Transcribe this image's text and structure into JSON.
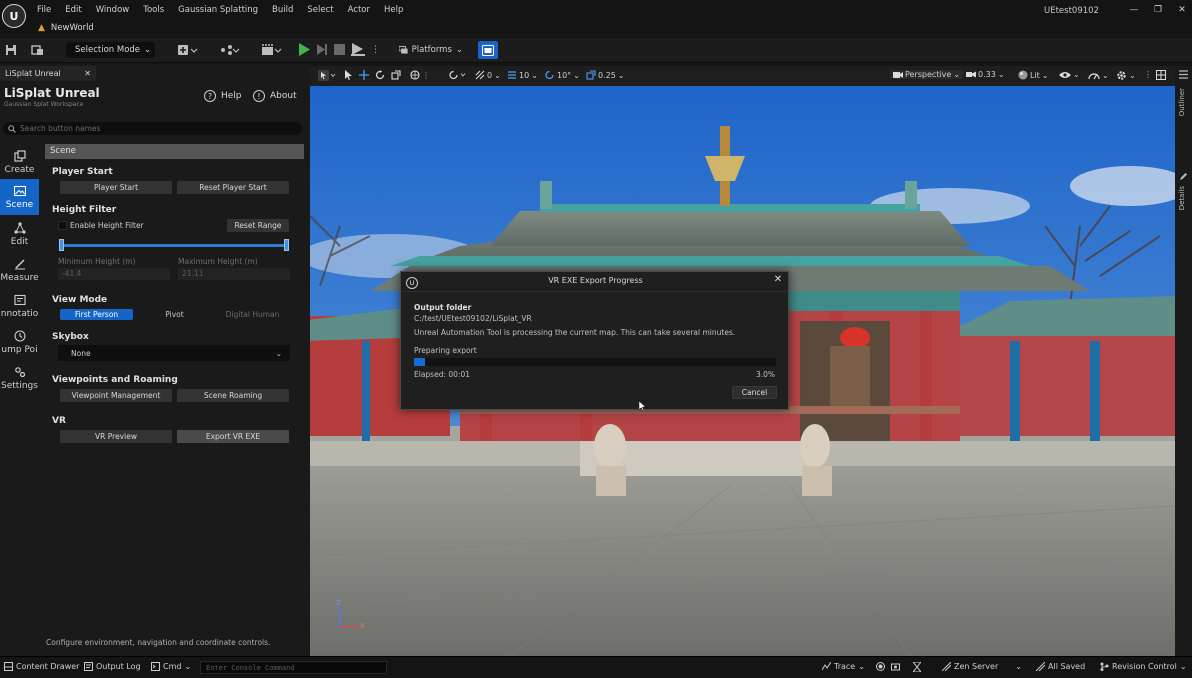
{
  "app": {
    "menu": [
      "File",
      "Edit",
      "Window",
      "Tools",
      "Gaussian Splatting",
      "Build",
      "Select",
      "Actor",
      "Help"
    ],
    "project_tab": "NewWorld",
    "window_title": "UEtest09102"
  },
  "toolbar": {
    "selection_mode": "Selection Mode",
    "platforms": "Platforms"
  },
  "panel": {
    "tab_label": "LiSplat Unreal",
    "title": "LiSplat Unreal",
    "subtitle": "Gaussian Splat Workspace",
    "help": "Help",
    "about": "About",
    "search_placeholder": "Search button names",
    "sidebar": [
      {
        "label": "Create",
        "icon": "create-icon"
      },
      {
        "label": "Scene",
        "icon": "image-icon",
        "active": true
      },
      {
        "label": "Edit",
        "icon": "edit-nodes-icon"
      },
      {
        "label": "Measure",
        "icon": "measure-icon"
      },
      {
        "label": "nnotatio",
        "icon": "annotation-icon"
      },
      {
        "label": "ump Poi",
        "icon": "jump-point-icon"
      },
      {
        "label": "Settings",
        "icon": "settings-icon"
      }
    ],
    "section_header": "Scene",
    "player_start": {
      "title": "Player Start",
      "btn_player_start": "Player Start",
      "btn_reset": "Reset Player Start"
    },
    "height_filter": {
      "title": "Height Filter",
      "enable_label": "Enable Height Filter",
      "enabled": false,
      "reset_range": "Reset Range",
      "min_label": "Minimum Height (m)",
      "min_value": "-41.4",
      "max_label": "Maximum Height (m)",
      "max_value": "21.11"
    },
    "view_mode": {
      "title": "View Mode",
      "options": [
        "First Person",
        "Pivot",
        "Digital Human"
      ],
      "selected": "First Person"
    },
    "skybox": {
      "title": "Skybox",
      "value": "None"
    },
    "viewpoints": {
      "title": "Viewpoints and Roaming",
      "btn_management": "Viewpoint Management",
      "btn_roaming": "Scene Roaming"
    },
    "vr": {
      "title": "VR",
      "btn_preview": "VR Preview",
      "btn_export": "Export VR EXE"
    },
    "footer_hint": "Configure environment, navigation and coordinate controls."
  },
  "viewport": {
    "snap_rotate": "0",
    "grid": "10",
    "angle": "10°",
    "scale": "0.25",
    "perspective": "Perspective",
    "camera_speed": "0.33",
    "lit": "Lit",
    "axis_z": "Z",
    "axis_x": "X",
    "right_tabs": [
      "Outliner",
      "Details"
    ]
  },
  "dialog": {
    "title": "VR EXE Export Progress",
    "output_label": "Output folder",
    "output_path": "C:/test/UEtest09102/LiSplat_VR",
    "message": "Unreal Automation Tool is processing the current map. This can take several minutes.",
    "status": "Preparing export",
    "elapsed": "Elapsed: 00:01",
    "percent_text": "3.0%",
    "progress": 0.03,
    "cancel": "Cancel"
  },
  "statusbar": {
    "content_drawer": "Content Drawer",
    "output_log": "Output Log",
    "cmd": "Cmd",
    "console_placeholder": "Enter Console Command",
    "trace": "Trace",
    "zen_server": "Zen Server",
    "all_saved": "All Saved",
    "revision_control": "Revision Control"
  },
  "colors": {
    "accent": "#1565c8",
    "play_green": "#3fb54b",
    "warning": "#e0a030"
  }
}
